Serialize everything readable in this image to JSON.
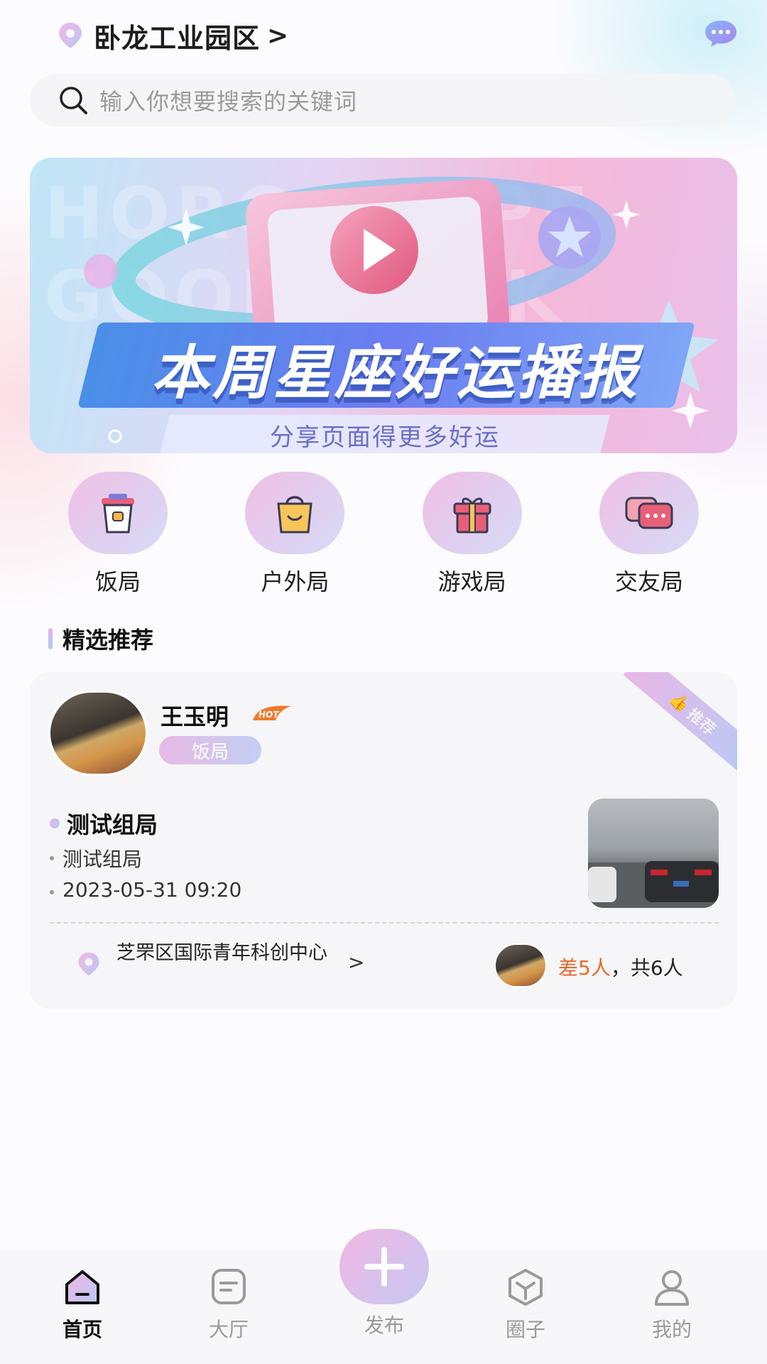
{
  "header": {
    "title": "卧龙工业园区",
    "chevron": ">"
  },
  "search": {
    "placeholder": "输入你想要搜索的关键词"
  },
  "banner": {
    "watermark": "HOROSCOPE GOOD LUCK",
    "heading": "本周星座好运播报",
    "subtitle": "分享页面得更多好运"
  },
  "categories": [
    {
      "label": "饭局",
      "icon": "food-box-icon"
    },
    {
      "label": "户外局",
      "icon": "shopping-bag-icon"
    },
    {
      "label": "游戏局",
      "icon": "gift-box-icon"
    },
    {
      "label": "交友局",
      "icon": "chat-bubbles-icon"
    }
  ],
  "section": {
    "title": "精选推荐"
  },
  "card": {
    "ribbon": "推荐",
    "username": "王玉明",
    "hot_badge": "HOT",
    "tag": "饭局",
    "activity_title": "测试组局",
    "description": "测试组局",
    "datetime": "2023-05-31 09:20",
    "address": "芝罘区国际青年科创中心",
    "address_chevron": ">",
    "people_missing": "差5人",
    "people_total": "，共6人"
  },
  "nav": {
    "home": "首页",
    "hall": "大厅",
    "publish": "发布",
    "circle": "圈子",
    "mine": "我的"
  },
  "colors": {
    "accent_gradient_start": "#f0b7e2",
    "accent_gradient_end": "#c6c8f4",
    "missing_people": "#e96a2a"
  }
}
